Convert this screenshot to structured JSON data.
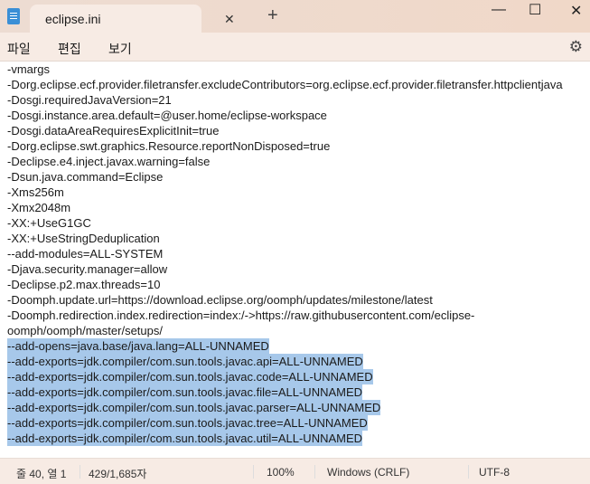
{
  "window": {
    "tab_title": "eclipse.ini",
    "icons": [
      "notepad-icon",
      "close-icon",
      "plus-icon",
      "minimize-icon",
      "maximize-icon",
      "close-window-icon",
      "gear-icon"
    ]
  },
  "menu": {
    "file": "파일",
    "edit": "편집",
    "view": "보기"
  },
  "lines": [
    {
      "text": "-vmargs",
      "selected": false
    },
    {
      "text": "-Dorg.eclipse.ecf.provider.filetransfer.excludeContributors=org.eclipse.ecf.provider.filetransfer.httpclientjava",
      "selected": false
    },
    {
      "text": "-Dosgi.requiredJavaVersion=21",
      "selected": false
    },
    {
      "text": "-Dosgi.instance.area.default=@user.home/eclipse-workspace",
      "selected": false
    },
    {
      "text": "-Dosgi.dataAreaRequiresExplicitInit=true",
      "selected": false
    },
    {
      "text": "-Dorg.eclipse.swt.graphics.Resource.reportNonDisposed=true",
      "selected": false
    },
    {
      "text": "-Declipse.e4.inject.javax.warning=false",
      "selected": false
    },
    {
      "text": "-Dsun.java.command=Eclipse",
      "selected": false
    },
    {
      "text": "-Xms256m",
      "selected": false
    },
    {
      "text": "-Xmx2048m",
      "selected": false
    },
    {
      "text": "-XX:+UseG1GC",
      "selected": false
    },
    {
      "text": "-XX:+UseStringDeduplication",
      "selected": false
    },
    {
      "text": "--add-modules=ALL-SYSTEM",
      "selected": false
    },
    {
      "text": "-Djava.security.manager=allow",
      "selected": false
    },
    {
      "text": "-Declipse.p2.max.threads=10",
      "selected": false
    },
    {
      "text": "-Doomph.update.url=https://download.eclipse.org/oomph/updates/milestone/latest",
      "selected": false
    },
    {
      "text": "-Doomph.redirection.index.redirection=index:/->https://raw.githubusercontent.com/eclipse-",
      "selected": false
    },
    {
      "text": "oomph/oomph/master/setups/",
      "selected": false
    },
    {
      "text": "--add-opens=java.base/java.lang=ALL-UNNAMED",
      "selected": true
    },
    {
      "text": "--add-exports=jdk.compiler/com.sun.tools.javac.api=ALL-UNNAMED",
      "selected": true
    },
    {
      "text": "--add-exports=jdk.compiler/com.sun.tools.javac.code=ALL-UNNAMED",
      "selected": true
    },
    {
      "text": "--add-exports=jdk.compiler/com.sun.tools.javac.file=ALL-UNNAMED",
      "selected": true
    },
    {
      "text": "--add-exports=jdk.compiler/com.sun.tools.javac.parser=ALL-UNNAMED",
      "selected": true
    },
    {
      "text": "--add-exports=jdk.compiler/com.sun.tools.javac.tree=ALL-UNNAMED",
      "selected": true
    },
    {
      "text": "--add-exports=jdk.compiler/com.sun.tools.javac.util=ALL-UNNAMED",
      "selected": true
    }
  ],
  "status": {
    "position": "줄 40, 열 1",
    "chars": "429/1,685자",
    "zoom": "100%",
    "line_ending": "Windows (CRLF)",
    "encoding": "UTF-8"
  }
}
